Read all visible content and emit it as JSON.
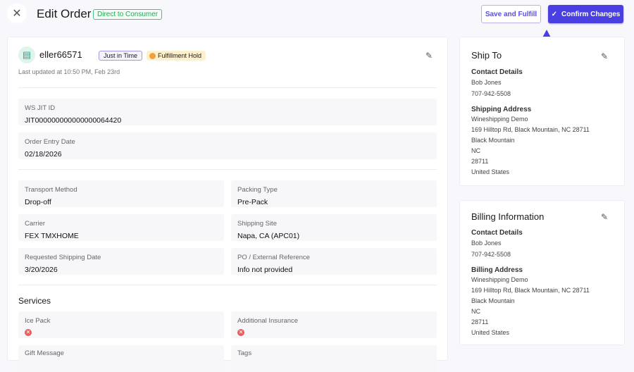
{
  "header": {
    "title": "Edit Order",
    "channel_tag": "Direct to Consumer",
    "save_fulfill": "Save and Fulfill",
    "confirm": "Confirm Changes"
  },
  "order": {
    "id": "eller66571",
    "type_tag": "Just in Time",
    "status_tag": "Fulfillment Hold",
    "updated": "Last updated at 10:50 PM, Feb 23rd"
  },
  "fields": {
    "ws_jit_id": {
      "label": "WS JIT ID",
      "value": "JIT000000000000000064420"
    },
    "order_entry_date": {
      "label": "Order Entry Date",
      "value": "02/18/2026"
    },
    "transport": {
      "label": "Transport Method",
      "value": "Drop-off"
    },
    "packing": {
      "label": "Packing Type",
      "value": "Pre-Pack"
    },
    "carrier": {
      "label": "Carrier",
      "value": "FEX TMXHOME"
    },
    "site": {
      "label": "Shipping Site",
      "value": "Napa, CA (APC01)"
    },
    "req_date": {
      "label": "Requested Shipping Date",
      "value": "3/20/2026"
    },
    "po": {
      "label": "PO / External Reference",
      "value": "Info not provided"
    }
  },
  "services": {
    "heading": "Services",
    "ice_pack": "Ice Pack",
    "insurance": "Additional Insurance",
    "gift": "Gift Message",
    "tags": "Tags"
  },
  "ship_to": {
    "title": "Ship To",
    "contact_h": "Contact Details",
    "name": "Bob Jones",
    "phone": "707-942-5508",
    "addr_h": "Shipping Address",
    "lines": [
      "Wineshipping Demo",
      "169 Hilltop Rd, Black Mountain, NC 28711",
      "Black Mountain",
      "NC",
      "28711",
      "United States"
    ]
  },
  "billing": {
    "title": "Billing Information",
    "contact_h": "Contact Details",
    "name": "Bob Jones",
    "phone": "707-942-5508",
    "addr_h": "Billing Address",
    "lines": [
      "Wineshipping Demo",
      "169 Hilltop Rd, Black Mountain, NC 28711",
      "Black Mountain",
      "NC",
      "28711",
      "United States"
    ]
  },
  "colors": {
    "primary": "#4a3fe0",
    "arrow": "#4a3fe0"
  }
}
